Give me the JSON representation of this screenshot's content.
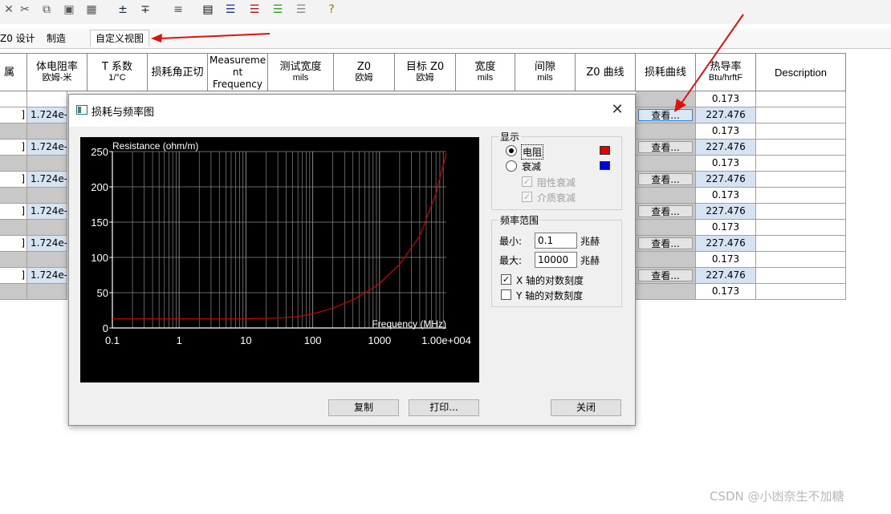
{
  "toolbar": {
    "icons": [
      "close-icon",
      "cut-icon",
      "copy-icon",
      "paste-icon",
      "paste-special-icon",
      "insert-row-above-icon",
      "insert-row-below-icon",
      "sort-icon",
      "table-icon",
      "align-lines-icon",
      "red-lines-icon",
      "green-lines-icon",
      "gray-lines-icon",
      "help-icon"
    ]
  },
  "tabs": [
    {
      "label": "Z0 设计"
    },
    {
      "label": "制造"
    },
    {
      "label": "自定义视图",
      "active": true
    }
  ],
  "grid": {
    "columns": [
      {
        "label": "属",
        "sub": ""
      },
      {
        "label": "体电阻率",
        "sub": "欧姆-米"
      },
      {
        "label": "T 系数",
        "sub": "1/°C"
      },
      {
        "label": "损耗角正切",
        "sub": ""
      },
      {
        "label": "Measureme nt Frequency",
        "sub": ""
      },
      {
        "label": "测试宽度",
        "sub": "mils"
      },
      {
        "label": "Z0",
        "sub": "欧姆"
      },
      {
        "label": "目标 Z0",
        "sub": "欧姆"
      },
      {
        "label": "宽度",
        "sub": "mils"
      },
      {
        "label": "间隙",
        "sub": "mils"
      },
      {
        "label": "Z0 曲线",
        "sub": ""
      },
      {
        "label": "损耗曲线",
        "sub": ""
      },
      {
        "label": "热导率",
        "sub": "Btu/hrftF"
      },
      {
        "label": "Description",
        "sub": ""
      }
    ],
    "row_values": {
      "resistivity": "1.724e-008",
      "conductivity_a": "0.173",
      "conductivity_b": "227.476",
      "view_button": "查看..."
    }
  },
  "dialog": {
    "title": "损耗与频率图",
    "display_group": {
      "title": "显示",
      "resistance_label": "电阻",
      "attenuation_label": "衰减",
      "resistive_label": "阻性衰减",
      "dielectric_label": "介质衰减",
      "resistance_color": "#e00000",
      "attenuation_color": "#0000e0",
      "selected": "resistance"
    },
    "freq_group": {
      "title": "频率范围",
      "min_label": "最小:",
      "min_value": "0.1",
      "max_label": "最大:",
      "max_value": "10000",
      "unit": "兆赫",
      "x_log_label": "X 轴的对数刻度",
      "x_log_checked": true,
      "y_log_label": "Y 轴的对数刻度",
      "y_log_checked": false
    },
    "buttons": {
      "copy": "复制",
      "print": "打印...",
      "close": "关闭"
    }
  },
  "chart_data": {
    "type": "line",
    "ylabel": "Resistance (ohm/m)",
    "xlabel": "Frequency (MHz)",
    "x_scale": "log",
    "xlim": [
      0.1,
      10000
    ],
    "ylim": [
      0,
      250
    ],
    "xticks": [
      "0.1",
      "1",
      "10",
      "100",
      "1000",
      "1.00e+004"
    ],
    "yticks": [
      "0",
      "50",
      "100",
      "150",
      "200",
      "250"
    ],
    "grid": true,
    "background": "#000000",
    "line_color": "#cc0000",
    "series": [
      {
        "x": [
          0.1,
          1,
          10,
          30,
          60,
          100,
          200,
          400,
          700,
          1000,
          2000,
          4000,
          7000,
          10000
        ],
        "y": [
          13,
          13,
          13,
          14,
          16,
          20,
          28,
          40,
          53,
          63,
          90,
          130,
          190,
          248
        ]
      }
    ]
  },
  "watermark": "CSDN @小凼奈生不加糖"
}
